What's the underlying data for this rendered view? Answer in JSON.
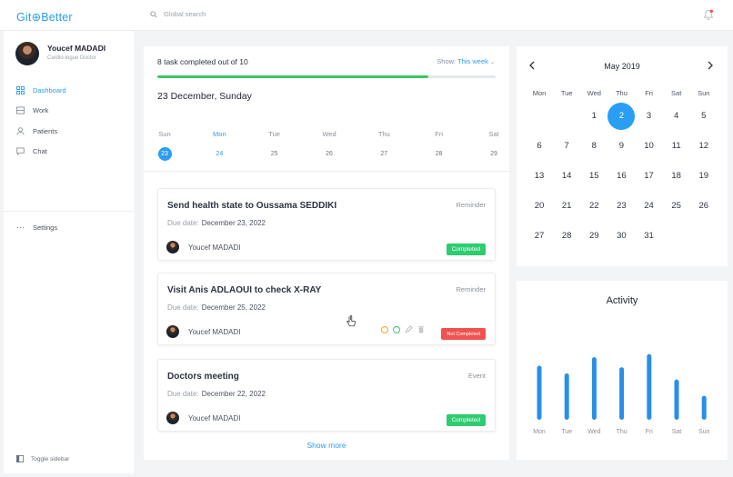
{
  "app": {
    "logo": "Git⊕Better"
  },
  "search": {
    "placeholder": "Global search",
    "icon": "search-icon"
  },
  "profile": {
    "name": "Youcef MADADI",
    "role": "Cardio-logue Doctor"
  },
  "nav": [
    {
      "label": "Dashboard",
      "icon": "grid-icon",
      "active": true
    },
    {
      "label": "Work",
      "icon": "briefcase-icon"
    },
    {
      "label": "Patients",
      "icon": "user-icon"
    },
    {
      "label": "Chat",
      "icon": "chat-icon"
    }
  ],
  "settings": {
    "label": "Settings",
    "icon": "more-icon"
  },
  "toggle": {
    "label": "Toggle sidebar",
    "icon": "sidebar-icon"
  },
  "tasks": {
    "summary": "8 task completed out of 10",
    "completed": 8,
    "total": 10,
    "show_label": "Show:",
    "show_value": "This week",
    "current_date": "23 December, Sunday",
    "week": [
      {
        "day": "Sun",
        "date": "23",
        "today": true
      },
      {
        "day": "Mon",
        "date": "24",
        "selected": true
      },
      {
        "day": "Tue",
        "date": "25"
      },
      {
        "day": "Wed",
        "date": "26"
      },
      {
        "day": "Thu",
        "date": "27"
      },
      {
        "day": "Fri",
        "date": "28"
      },
      {
        "day": "Sat",
        "date": "29"
      }
    ],
    "items": [
      {
        "title": "Send health state to Oussama SEDDIKI",
        "type": "Reminder",
        "due_label": "Due date:",
        "due": "December 23, 2022",
        "user": "Youcef MADADI",
        "status": "Completed"
      },
      {
        "title": "Visit Anis ADLAOUI to check X-RAY",
        "type": "Reminder",
        "due_label": "Due date:",
        "due": "December 25, 2022",
        "user": "Youcef MADADI",
        "status": "Not Completed"
      },
      {
        "title": "Doctors meeting",
        "type": "Event",
        "due_label": "Due date:",
        "due": "December 22, 2022",
        "user": "Youcef MADADI",
        "status": "Completed"
      }
    ],
    "show_more": "Show more"
  },
  "calendar": {
    "month": "May 2019",
    "weekdays": [
      "Mon",
      "Tue",
      "Wed",
      "Thu",
      "Fri",
      "Sat",
      "Sun"
    ],
    "days": [
      "",
      "",
      "1",
      "2",
      "3",
      "4",
      "5",
      "6",
      "7",
      "8",
      "9",
      "10",
      "11",
      "12",
      "13",
      "14",
      "15",
      "16",
      "17",
      "18",
      "19",
      "20",
      "21",
      "22",
      "23",
      "24",
      "25",
      "26",
      "27",
      "28",
      "29",
      "30",
      "31"
    ],
    "selected": "2"
  },
  "activity": {
    "title": "Activity",
    "color": "#2a8ee8"
  },
  "chart_data": {
    "type": "bar",
    "title": "Activity",
    "categories": [
      "Mon",
      "Tue",
      "Wed",
      "Thu",
      "Fri",
      "Sat",
      "Sun"
    ],
    "values": [
      70,
      60,
      81,
      68,
      85,
      52,
      31
    ],
    "ylim": [
      0,
      100
    ]
  },
  "colors": {
    "accent": "#2a9df4",
    "success": "#2ecc71",
    "danger": "#ef5350",
    "progress": "#3ec764"
  }
}
